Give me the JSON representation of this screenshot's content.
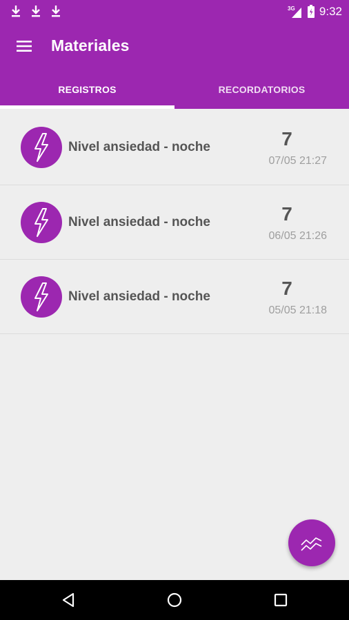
{
  "status_bar": {
    "time": "9:32",
    "network": "3G",
    "icons": [
      "download-icon",
      "download-icon",
      "download-icon",
      "signal-icon",
      "battery-icon"
    ]
  },
  "toolbar": {
    "title": "Materiales",
    "menu_icon": "hamburger-menu-icon"
  },
  "tabs": [
    {
      "label": "REGISTROS",
      "selected": true
    },
    {
      "label": "RECORDATORIOS",
      "selected": false
    }
  ],
  "records": [
    {
      "label": "Nivel ansiedad - noche",
      "value": "7",
      "date": "07/05 21:27",
      "icon": "lightning-bolt-icon"
    },
    {
      "label": "Nivel ansiedad - noche",
      "value": "7",
      "date": "06/05 21:26",
      "icon": "lightning-bolt-icon"
    },
    {
      "label": "Nivel ansiedad - noche",
      "value": "7",
      "date": "05/05 21:18",
      "icon": "lightning-bolt-icon"
    }
  ],
  "fab": {
    "icon": "trending-chart-icon"
  },
  "nav_bar": {
    "icons": [
      "back-icon",
      "home-icon",
      "recents-icon"
    ]
  },
  "colors": {
    "primary": "#9c27b0",
    "background": "#eeeeee",
    "text_primary": "#555555",
    "text_secondary": "#9e9e9e"
  }
}
